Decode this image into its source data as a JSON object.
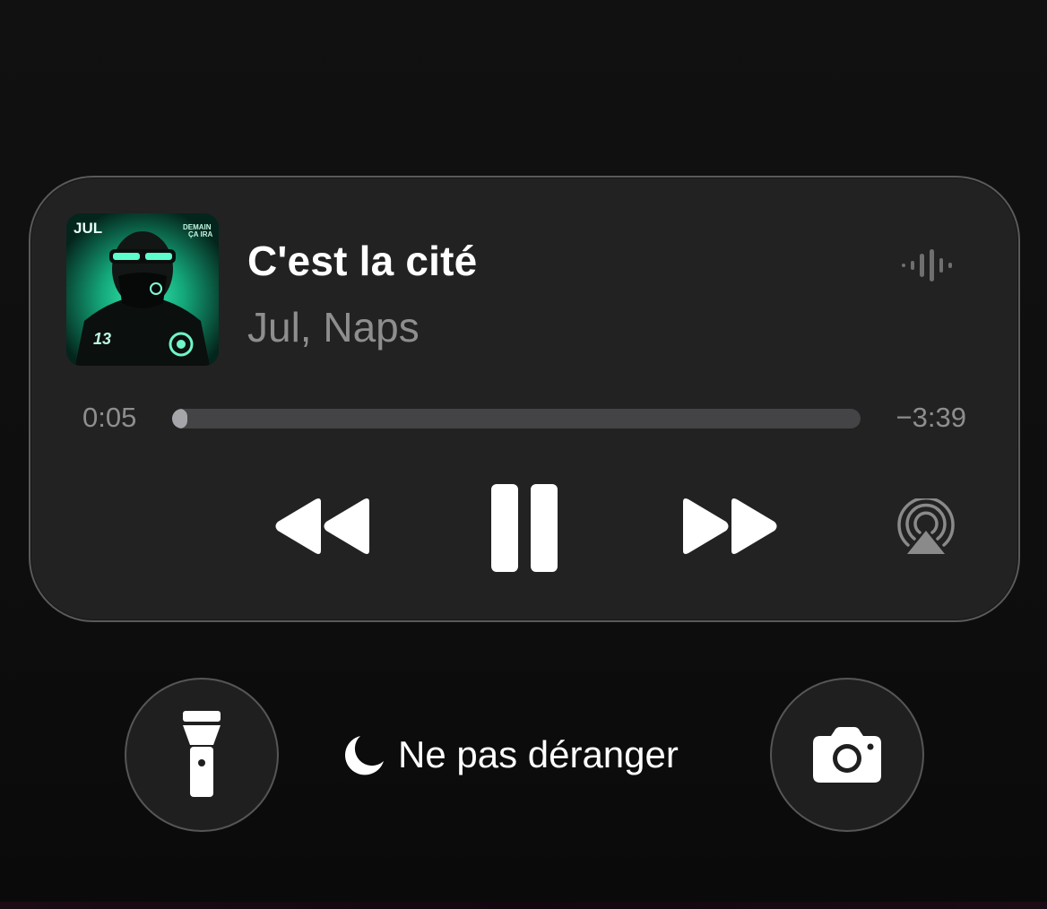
{
  "now_playing": {
    "title": "C'est la cité",
    "artist": "Jul, Naps",
    "artwork": {
      "artist_tag": "JUL",
      "album_tag_line1": "DEMAIN",
      "album_tag_line2": "ÇA IRA",
      "jersey_number": "13"
    },
    "time_elapsed": "0:05",
    "time_remaining": "−3:39",
    "progress_fraction": 0.022
  },
  "controls": {
    "rewind_icon": "rewind-icon",
    "pause_icon": "pause-icon",
    "forward_icon": "fast-forward-icon",
    "airplay_icon": "airplay-audio-icon",
    "waveform_icon": "waveform-icon"
  },
  "quick_actions": {
    "flashlight_icon": "flashlight-icon",
    "focus_label": "Ne pas déranger",
    "focus_icon": "moon-icon",
    "camera_icon": "camera-icon"
  },
  "colors": {
    "card_background": "#222222",
    "primary_text": "#ffffff",
    "secondary_text": "#8e8e8e",
    "progress_track": "#444446",
    "progress_fill": "#a6a6aa",
    "artwork_glow": "#2ee6a8"
  }
}
